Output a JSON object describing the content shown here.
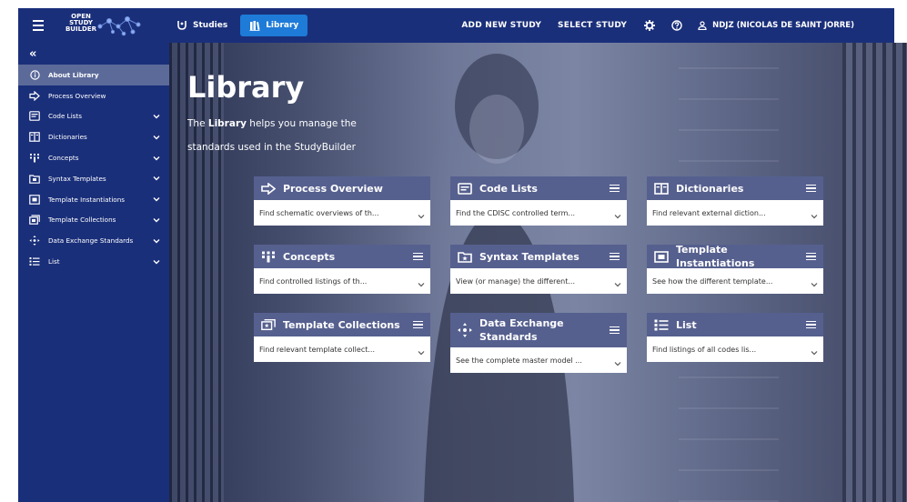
{
  "logo": {
    "line1": "OPEN",
    "line2": "STUDY",
    "line3": "BUILDER"
  },
  "header": {
    "nav": [
      {
        "label": "Studies"
      },
      {
        "label": "Library"
      }
    ],
    "actions": [
      "ADD NEW STUDY",
      "SELECT STUDY"
    ],
    "user": "NDJZ (NICOLAS DE SAINT JORRE)"
  },
  "sidebar": {
    "collapse": "«",
    "items": [
      {
        "label": "About Library",
        "active": true
      },
      {
        "label": "Process Overview"
      },
      {
        "label": "Code Lists"
      },
      {
        "label": "Dictionaries"
      },
      {
        "label": "Concepts"
      },
      {
        "label": "Syntax Templates"
      },
      {
        "label": "Template Instantiations"
      },
      {
        "label": "Template Collections"
      },
      {
        "label": "Data Exchange Standards"
      },
      {
        "label": "List"
      }
    ]
  },
  "main": {
    "title": "Library",
    "intro_pre": "The ",
    "intro_bold": "Library",
    "intro_post": " helps you manage the standards used in the StudyBuilder",
    "cards": [
      {
        "title": "Process Overview",
        "desc": "Find schematic overviews of th..."
      },
      {
        "title": "Code Lists",
        "desc": "Find the CDISC controlled term..."
      },
      {
        "title": "Dictionaries",
        "desc": "Find relevant external diction..."
      },
      {
        "title": "Concepts",
        "desc": "Find controlled listings of th..."
      },
      {
        "title": "Syntax Templates",
        "desc": "View (or manage) the different..."
      },
      {
        "title": "Template Instantiations",
        "desc": "See how the different template..."
      },
      {
        "title": "Template Collections",
        "desc": "Find relevant template collect..."
      },
      {
        "title": "Data Exchange Standards",
        "desc": "See the complete master model ..."
      },
      {
        "title": "List",
        "desc": "Find listings of all codes lis..."
      }
    ]
  },
  "colors": {
    "primary": "#1a2f7a",
    "accent": "#1e7bd8",
    "card_header": "#56608f",
    "active_item": "#5c6a99"
  }
}
